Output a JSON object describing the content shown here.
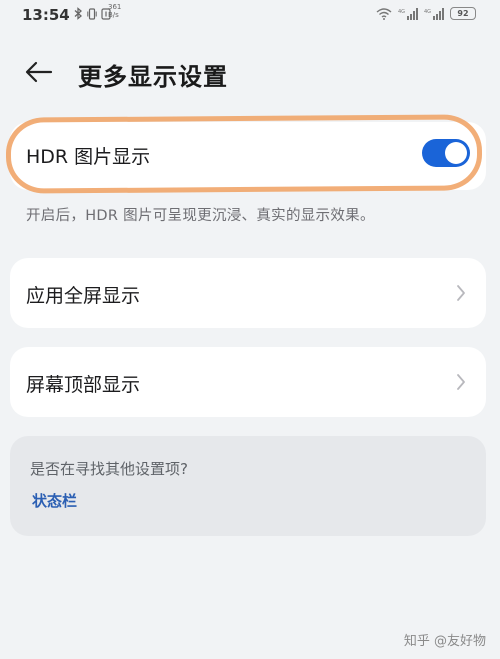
{
  "status_bar": {
    "time": "13:54",
    "net_speed_value": "361",
    "net_speed_unit": "B/s",
    "battery": "92"
  },
  "header": {
    "title": "更多显示设置"
  },
  "hdr": {
    "label": "HDR 图片显示",
    "enabled": true,
    "description": "开启后，HDR 图片可呈现更沉浸、真实的显示效果。"
  },
  "items": [
    {
      "label": "应用全屏显示"
    },
    {
      "label": "屏幕顶部显示"
    }
  ],
  "suggestion": {
    "question": "是否在寻找其他设置项?",
    "link": "状态栏"
  },
  "watermark": "知乎 @友好物",
  "colors": {
    "accent": "#1a64d8",
    "link": "#2b5fb3",
    "highlight": "#f0a060"
  }
}
